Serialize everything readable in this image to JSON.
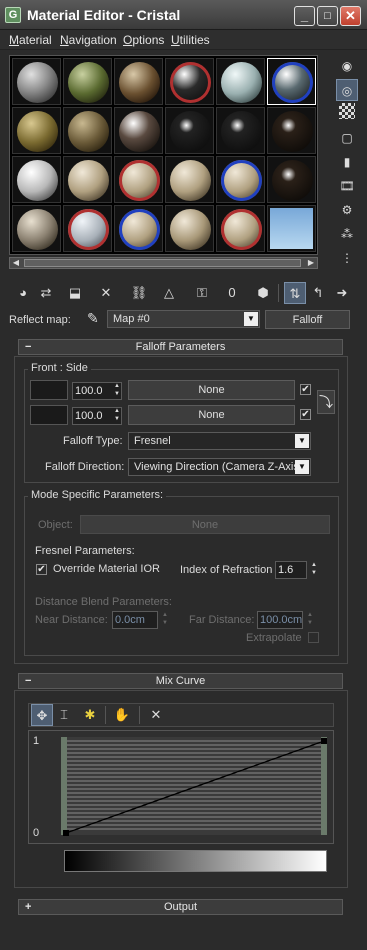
{
  "window": {
    "title": "Material Editor - Cristal",
    "app_icon": "G",
    "minimize": "_",
    "maximize": "□",
    "close": "✕"
  },
  "menu": {
    "items": [
      "Material",
      "Navigation",
      "Options",
      "Utilities"
    ],
    "accel": [
      "M",
      "N",
      "O",
      "U"
    ],
    "rest": [
      "aterial",
      "avigation",
      "ptions",
      "tilities"
    ]
  },
  "reflect": {
    "label": "Reflect map:",
    "map_name": "Map #0",
    "map_type": "Falloff"
  },
  "falloff": {
    "rollout_title": "Falloff Parameters",
    "sign": "−",
    "front_side_title": "Front : Side",
    "row1": {
      "amount": "100.0",
      "map": "None",
      "checked": "✔"
    },
    "row2": {
      "amount": "100.0",
      "map": "None",
      "checked": "✔"
    },
    "falloff_type_label": "Falloff Type:",
    "falloff_type": "Fresnel",
    "falloff_dir_label": "Falloff Direction:",
    "falloff_dir": "Viewing Direction (Camera Z-Axis)"
  },
  "mode": {
    "title": "Mode Specific Parameters:",
    "object_label": "Object:",
    "object_value": "None",
    "fresnel_title": "Fresnel Parameters:",
    "override_label": "Override Material IOR",
    "override_check": "✔",
    "ior_label": "Index of Refraction",
    "ior_value": "1.6",
    "distance_title": "Distance Blend Parameters:",
    "near_label": "Near Distance:",
    "near_value": "0.0cm",
    "far_label": "Far Distance:",
    "far_value": "100.0cm",
    "extrapolate_label": "Extrapolate"
  },
  "mix_curve": {
    "rollout_title": "Mix Curve",
    "sign": "−",
    "y_top": "1",
    "y_bottom": "0"
  },
  "output": {
    "rollout_title": "Output",
    "sign": "+"
  },
  "icons": {
    "sample_type": "sphere-icon",
    "backlight": "backlight-icon",
    "background": "checker-icon"
  }
}
